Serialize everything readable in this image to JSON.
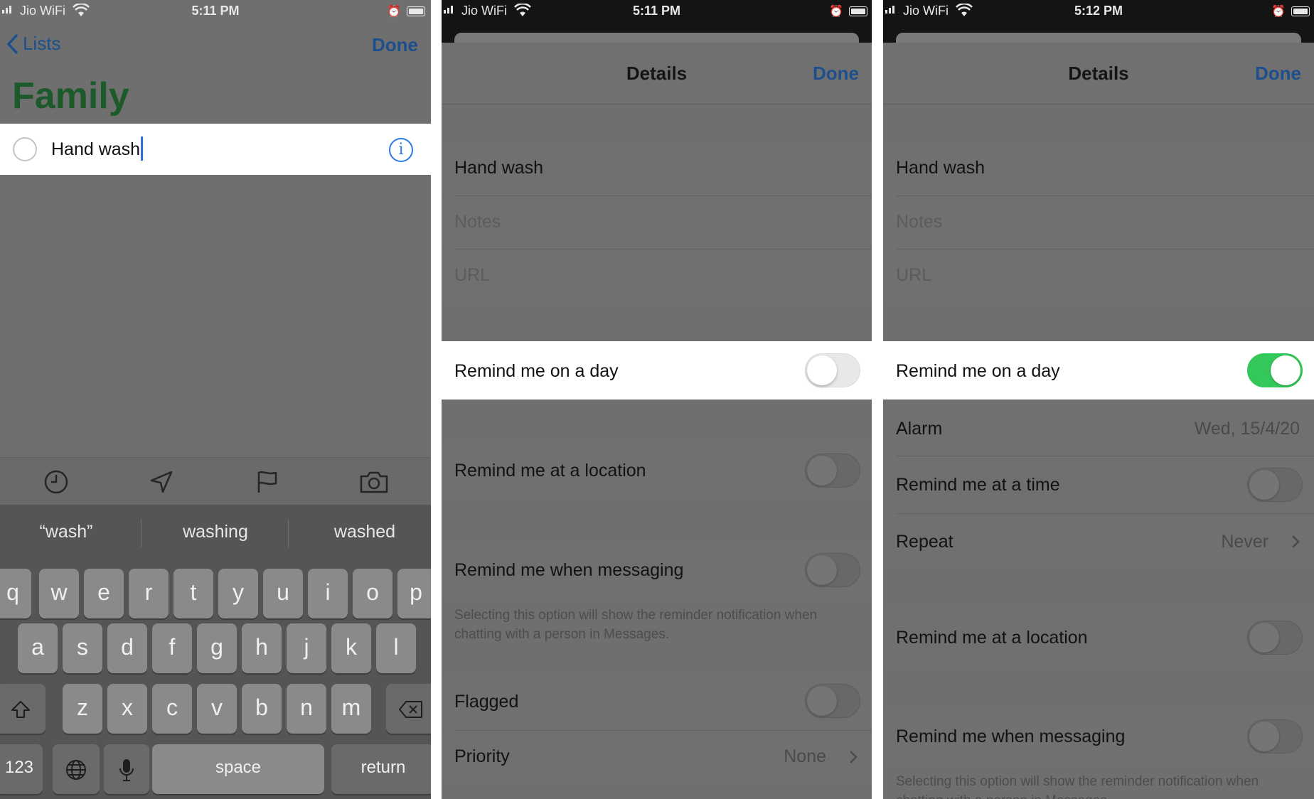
{
  "colors": {
    "accent_blue": "#1d4f8c",
    "list_green": "#1c5a2c",
    "toggle_on": "#34c759",
    "info_blue": "#2f7ae8"
  },
  "panel1": {
    "status": {
      "carrier": "Jio WiFi",
      "time": "5:11 PM"
    },
    "nav": {
      "back_label": "Lists",
      "done_label": "Done"
    },
    "list_title": "Family",
    "item": {
      "title": "Hand wash",
      "info_icon": "info-circle-icon"
    },
    "toolbar_icons": [
      "clock-icon",
      "location-arrow-icon",
      "flag-icon",
      "camera-icon"
    ],
    "suggestions": [
      "“wash”",
      "washing",
      "washed"
    ],
    "keyboard": {
      "row1": [
        "q",
        "w",
        "e",
        "r",
        "t",
        "y",
        "u",
        "i",
        "o",
        "p"
      ],
      "row2": [
        "a",
        "s",
        "d",
        "f",
        "g",
        "h",
        "j",
        "k",
        "l"
      ],
      "row3": [
        "z",
        "x",
        "c",
        "v",
        "b",
        "n",
        "m"
      ],
      "numbers_key": "123",
      "space_key": "space",
      "return_key": "return"
    }
  },
  "panel2": {
    "status": {
      "carrier": "Jio WiFi",
      "time": "5:11 PM"
    },
    "header": {
      "title": "Details",
      "done_label": "Done"
    },
    "title_value": "Hand wash",
    "notes_placeholder": "Notes",
    "url_placeholder": "URL",
    "remind_day": {
      "label": "Remind me on a day",
      "on": false
    },
    "remind_location": {
      "label": "Remind me at a location",
      "on": false
    },
    "remind_messaging": {
      "label": "Remind me when messaging",
      "on": false
    },
    "messaging_note": "Selecting this option will show the reminder notification when chatting with a person in Messages.",
    "flagged": {
      "label": "Flagged",
      "on": false
    },
    "priority": {
      "label": "Priority",
      "value": "None"
    }
  },
  "panel3": {
    "status": {
      "carrier": "Jio WiFi",
      "time": "5:12 PM"
    },
    "header": {
      "title": "Details",
      "done_label": "Done"
    },
    "title_value": "Hand wash",
    "notes_placeholder": "Notes",
    "url_placeholder": "URL",
    "remind_day": {
      "label": "Remind me on a day",
      "on": true
    },
    "alarm": {
      "label": "Alarm",
      "value": "Wed, 15/4/20"
    },
    "remind_time": {
      "label": "Remind me at a time",
      "on": false
    },
    "repeat": {
      "label": "Repeat",
      "value": "Never"
    },
    "remind_location": {
      "label": "Remind me at a location",
      "on": false
    },
    "remind_messaging": {
      "label": "Remind me when messaging",
      "on": false
    },
    "messaging_note": "Selecting this option will show the reminder notification when chatting with a person in Messages."
  }
}
